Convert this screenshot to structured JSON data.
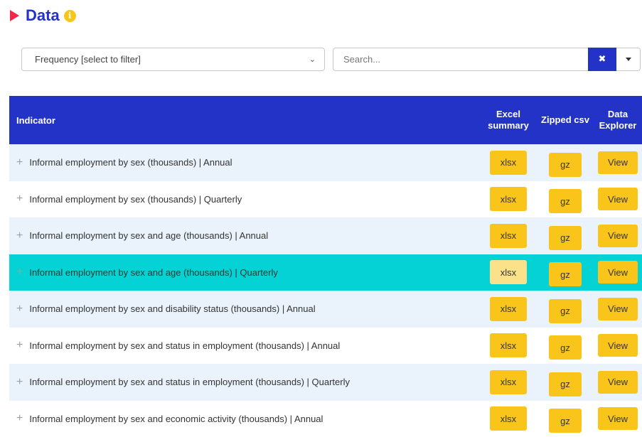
{
  "header": {
    "title": "Data",
    "info_glyph": "i"
  },
  "filter": {
    "frequency_label": "Frequency [select to filter]"
  },
  "search": {
    "placeholder": "Search...",
    "clear_glyph": "✖"
  },
  "table": {
    "headers": {
      "indicator": "Indicator",
      "excel_line1": "Excel",
      "excel_line2": "summary",
      "zipped": "Zipped csv",
      "explorer_line1": "Data",
      "explorer_line2": "Explorer"
    },
    "rows": [
      {
        "label": "Informal employment by sex (thousands) | Annual",
        "xlsx": "xlsx",
        "gz": "gz",
        "view": "View"
      },
      {
        "label": "Informal employment by sex (thousands) | Quarterly",
        "xlsx": "xlsx",
        "gz": "gz",
        "view": "View"
      },
      {
        "label": "Informal employment by sex and age (thousands) | Annual",
        "xlsx": "xlsx",
        "gz": "gz",
        "view": "View"
      },
      {
        "label": "Informal employment by sex and age (thousands) | Quarterly",
        "xlsx": "xlsx",
        "gz": "gz",
        "view": "View"
      },
      {
        "label": "Informal employment by sex and disability status (thousands) | Annual",
        "xlsx": "xlsx",
        "gz": "gz",
        "view": "View"
      },
      {
        "label": "Informal employment by sex and status in employment (thousands) | Annual",
        "xlsx": "xlsx",
        "gz": "gz",
        "view": "View"
      },
      {
        "label": "Informal employment by sex and status in employment (thousands) | Quarterly",
        "xlsx": "xlsx",
        "gz": "gz",
        "view": "View"
      },
      {
        "label": "Informal employment by sex and economic activity (thousands) | Annual",
        "xlsx": "xlsx",
        "gz": "gz",
        "view": "View"
      }
    ]
  },
  "colors": {
    "brand_blue": "#2433c7",
    "button_yellow": "#f9c51b",
    "highlight_row": "#05d2d4",
    "title_marker": "#f0284a"
  }
}
